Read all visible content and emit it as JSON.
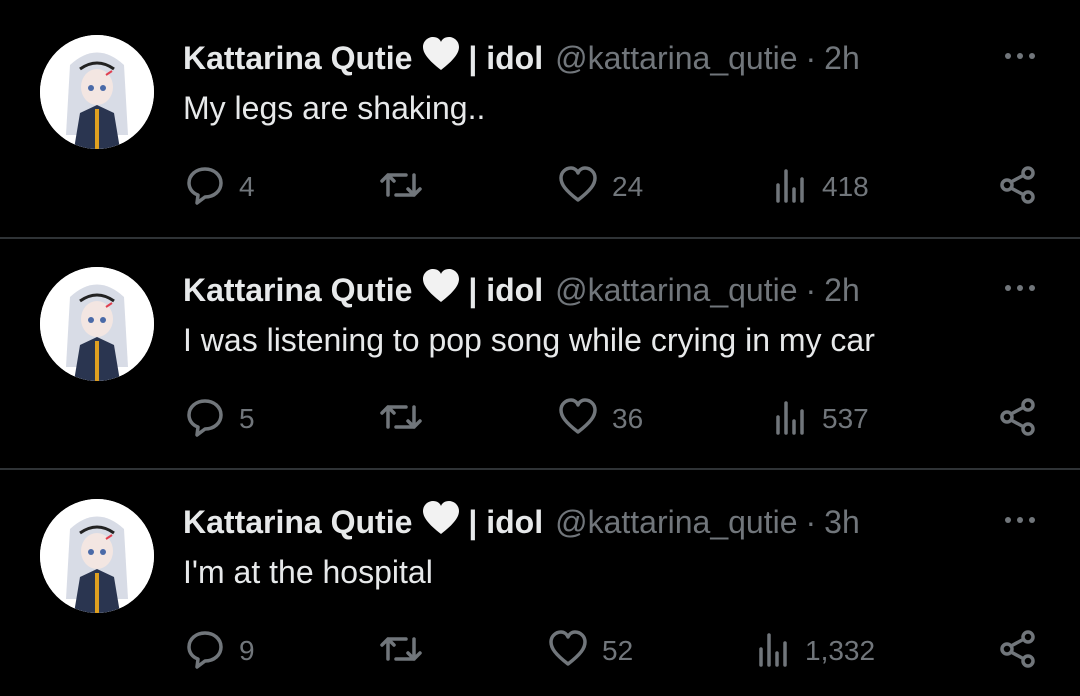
{
  "tweets": [
    {
      "author": "Kattarina Qutie",
      "name_suffix": "| idol",
      "handle": "@kattarina_qutie",
      "time": "2h",
      "text": "My legs are shaking..",
      "replies": "4",
      "retweets": "",
      "likes": "24",
      "views": "418"
    },
    {
      "author": "Kattarina Qutie",
      "name_suffix": "| idol",
      "handle": "@kattarina_qutie",
      "time": "2h",
      "text": "I was listening to pop song while crying in my car",
      "replies": "5",
      "retweets": "",
      "likes": "36",
      "views": "537"
    },
    {
      "author": "Kattarina Qutie",
      "name_suffix": "| idol",
      "handle": "@kattarina_qutie",
      "time": "3h",
      "text": "I'm at the hospital",
      "replies": "9",
      "retweets": "",
      "likes": "52",
      "views": "1,332"
    }
  ],
  "separator": "·",
  "icons": {
    "name_emoji": "white-heart-icon",
    "more": "more-options-icon",
    "reply": "reply-icon",
    "retweet": "retweet-icon",
    "like": "like-icon",
    "views": "views-icon",
    "share": "share-icon"
  },
  "colors": {
    "background": "#000000",
    "text": "#e7e9ea",
    "muted": "#71767b",
    "divider": "#2f3336"
  }
}
